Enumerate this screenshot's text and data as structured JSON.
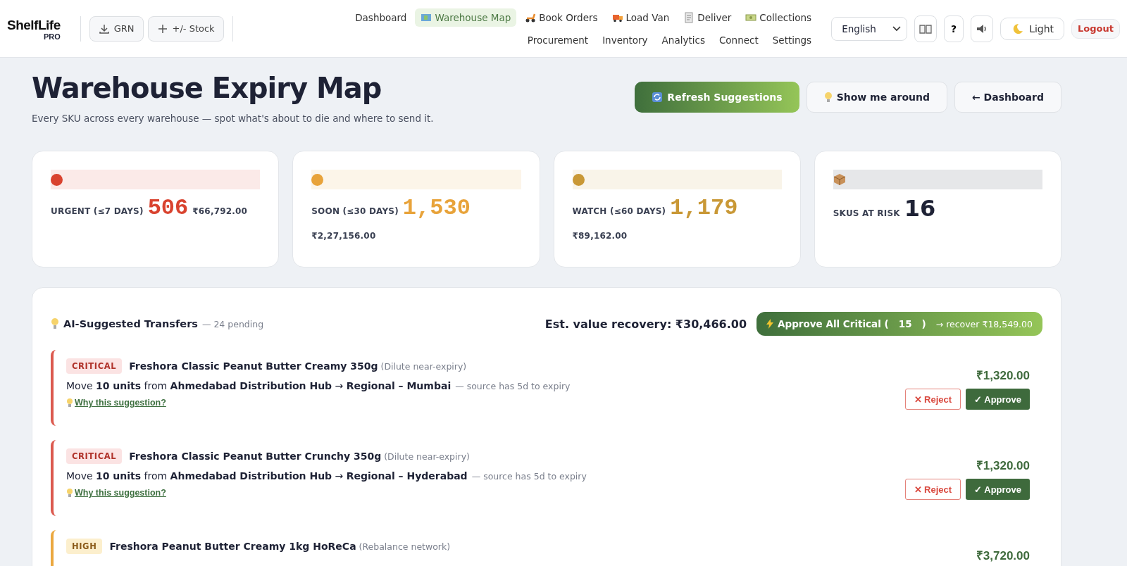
{
  "header": {
    "logo": {
      "name": "ShelfLife",
      "sub": "PRO"
    },
    "actions": [
      {
        "label": "GRN",
        "kind": "download"
      },
      {
        "label": "+/- Stock",
        "kind": "plus"
      }
    ],
    "nav_primary": [
      {
        "label": "Dashboard",
        "selected": false
      },
      {
        "label": "Warehouse Map",
        "selected": true
      },
      {
        "label": "Book Orders",
        "selected": false
      },
      {
        "label": "Load Van",
        "selected": false
      },
      {
        "label": "Deliver",
        "selected": false
      },
      {
        "label": "Collections",
        "selected": false
      }
    ],
    "nav_secondary": [
      "Procurement",
      "Inventory",
      "Analytics",
      "Connect",
      "Settings"
    ],
    "language": "English",
    "help": "?",
    "theme": "Light",
    "logout": "Logout"
  },
  "page": {
    "title": "Warehouse Expiry Map",
    "subtitle": "Every SKU across every warehouse — spot what's about to die and where to send it.",
    "buttons": [
      {
        "label": "Refresh Suggestions",
        "kind": "primary"
      },
      {
        "label": "Show me around",
        "kind": "tour"
      },
      {
        "label": "← Dashboard",
        "kind": "back"
      }
    ]
  },
  "stats": [
    {
      "kind": "dot",
      "color": "#d9432f",
      "label": "URGENT (≤7 DAYS)",
      "value": "506",
      "amount": "₹66,792.00"
    },
    {
      "kind": "dot",
      "color": "#e8a33a",
      "label": "SOON (≤30 DAYS)",
      "value": "1,530",
      "amount": "₹2,27,156.00"
    },
    {
      "kind": "dot",
      "color": "#c99836",
      "label": "WATCH (≤60 DAYS)",
      "value": "1,179",
      "amount": "₹89,162.00"
    },
    {
      "kind": "box",
      "color": "#1e2235",
      "label": "SKUS AT RISK",
      "value": "16"
    }
  ],
  "transfers": {
    "title": "AI-Suggested Transfers",
    "pending": "— 24 pending",
    "recovery": "Est. value recovery: ₹30,466.00",
    "approve_all": {
      "label": "Approve All Critical (",
      "count": "15",
      "close": ")",
      "recover": "→ recover ₹18,549.00"
    },
    "items": [
      {
        "kind": "critical",
        "badge": "CRITICAL",
        "product": "Freshora Classic Peanut Butter Creamy 350g",
        "reason": "(Dilute near-expiry)",
        "move": "Move **10 units** from **Ahmedabad Distribution Hub** → **Regional – Mumbai**",
        "note": "— source has 5d to expiry",
        "why": "Why this suggestion?",
        "value": "₹1,320.00",
        "reject": "✕ Reject",
        "approve": "✓ Approve"
      },
      {
        "kind": "critical",
        "badge": "CRITICAL",
        "product": "Freshora Classic Peanut Butter Crunchy 350g",
        "reason": "(Dilute near-expiry)",
        "move": "Move **10 units** from **Ahmedabad Distribution Hub** → **Regional – Hyderabad**",
        "note": "— source has 5d to expiry",
        "why": "Why this suggestion?",
        "value": "₹1,320.00",
        "reject": "✕ Reject",
        "approve": "✓ Approve"
      },
      {
        "kind": "high",
        "badge": "HIGH",
        "product": "Freshora Peanut Butter Creamy 1kg HoReCa",
        "reason": "(Rebalance network)",
        "value": "₹3,720.00"
      }
    ]
  }
}
